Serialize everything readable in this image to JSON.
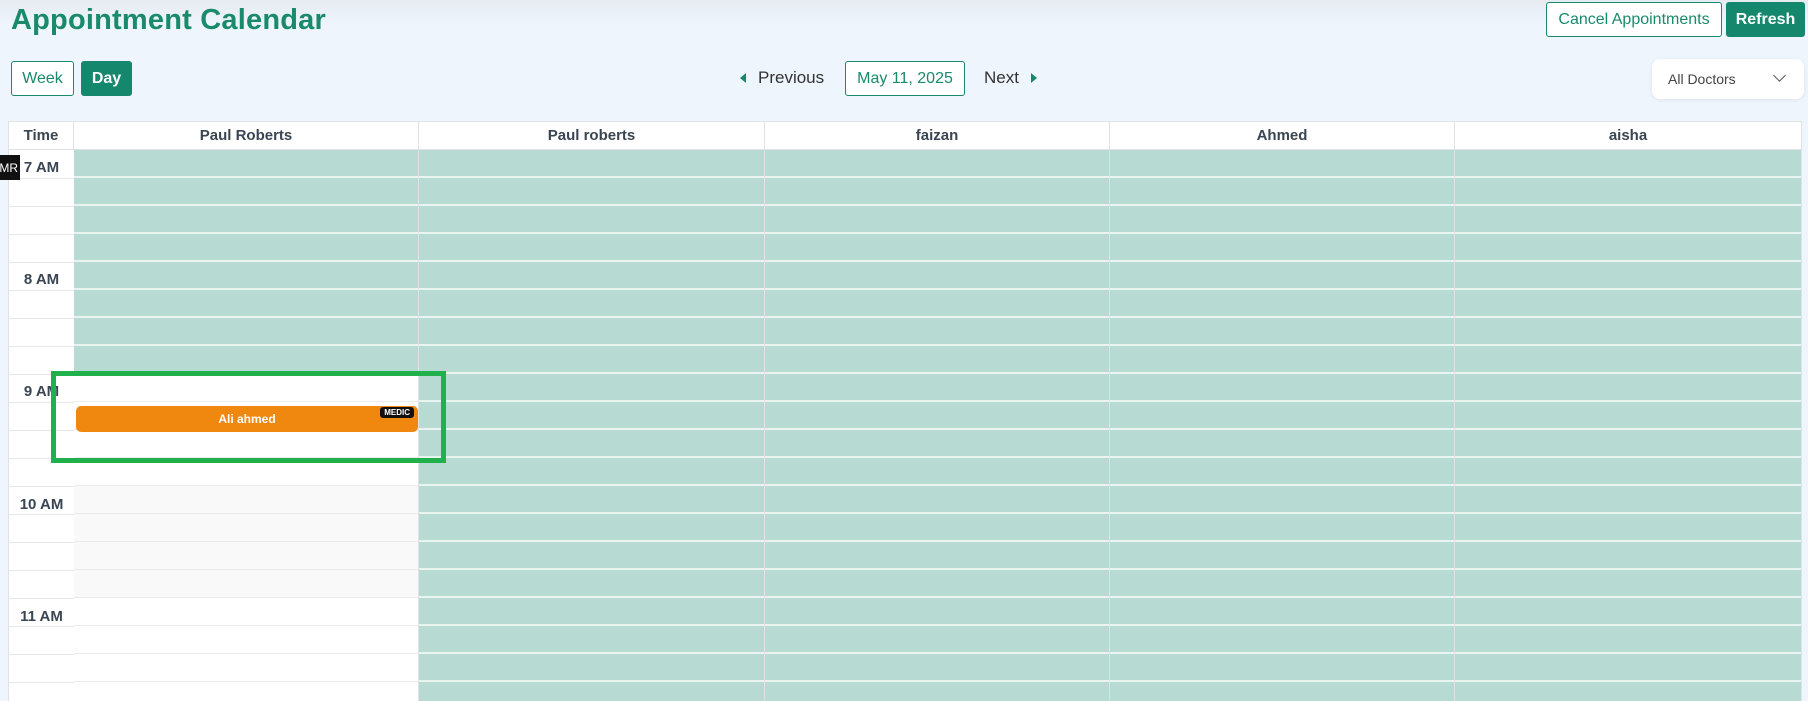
{
  "header": {
    "title": "Appointment Calendar",
    "cancel_label": "Cancel Appointments",
    "refresh_label": "Refresh"
  },
  "toolbar": {
    "view_week": "Week",
    "view_day": "Day",
    "active_view": "Day",
    "previous_label": "Previous",
    "date_label": "May 11, 2025",
    "next_label": "Next",
    "doctor_filter": "All Doctors"
  },
  "grid": {
    "time_header": "Time",
    "columns": [
      "Paul Roberts",
      "Paul roberts",
      "faizan",
      "Ahmed",
      "aisha"
    ],
    "time_labels": [
      "7 AM",
      "8 AM",
      "9 AM",
      "10 AM",
      "11 AM"
    ]
  },
  "appointment": {
    "patient": "Ali ahmed",
    "tag": "MEDIC",
    "doctor": "Paul Roberts",
    "time": "9 AM"
  },
  "side_tab": "MR",
  "colors": {
    "primary": "#15876c",
    "available_slot": "#b7dbd3",
    "appointment": "#f0880f",
    "highlight_box": "#21b14c"
  }
}
